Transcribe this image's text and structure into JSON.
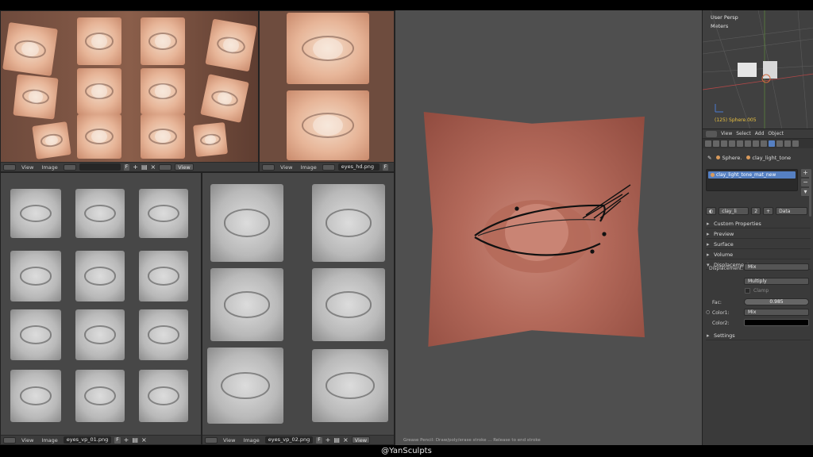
{
  "watermark": "@YanSculpts",
  "image_editors": {
    "top_left": {
      "menu_view": "View",
      "menu_image": "Image",
      "file": "",
      "f": "F",
      "view": "View"
    },
    "top_right": {
      "menu_view": "View",
      "menu_image": "Image",
      "file": "eyes_hd.png",
      "f": "F"
    },
    "bottom_left": {
      "menu_view": "View",
      "menu_image": "Image",
      "file": "eyes_vp_01.png",
      "f": "F"
    },
    "bottom_right": {
      "menu_view": "View",
      "menu_image": "Image",
      "file": "eyes_vp_02.png",
      "f": "F",
      "view": "View"
    }
  },
  "main_viewport": {
    "status": "Grease Pencil: Draw/poly/erase stroke ... Release to end stroke"
  },
  "outliner_view": {
    "perspective": "User Persp",
    "units": "Meters",
    "object_label": "(125) Sphere.005",
    "menu": [
      "View",
      "Select",
      "Add",
      "Object"
    ]
  },
  "properties": {
    "breadcrumb_object": "Sphere.",
    "breadcrumb_material": "clay_light_tone",
    "material_slot": "clay_light_tone_mat_new",
    "texture_name": "clay_li",
    "texture_users": "2",
    "texture_type": "Data",
    "panels": {
      "custom_properties": "Custom Properties",
      "preview": "Preview",
      "surface": "Surface",
      "volume": "Volume",
      "displacement": "Displacement",
      "settings": "Settings"
    },
    "displacement": {
      "label": "Displacement:",
      "value": "Mix",
      "blend": "Multiply",
      "clamp": "Clamp",
      "fac_label": "Fac:",
      "fac_value": "0.985",
      "color1_label": "Color1:",
      "color1_value": "Mix",
      "color2_label": "Color2:"
    }
  }
}
